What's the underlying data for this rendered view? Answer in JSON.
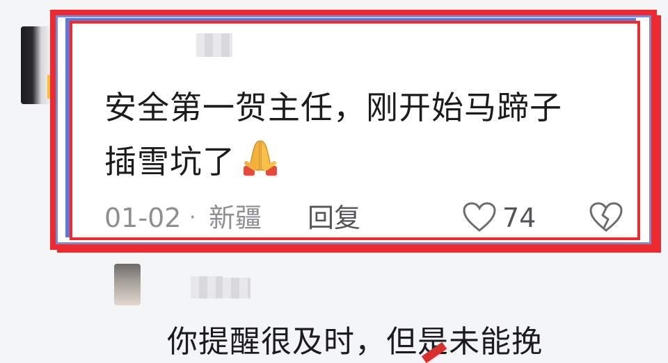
{
  "comment": {
    "text_line1": "安全第一贺主任，刚开始马蹄子",
    "text_line2": "插雪坑了",
    "emoji": "folded-hands",
    "date": "01-02",
    "separator": "·",
    "location": "新疆",
    "reply_label": "回复",
    "like_count": "74"
  },
  "reply": {
    "text": "你提醒很及时，但是未能挽"
  },
  "colors": {
    "highlight_border": "#ec2a2f",
    "secondary_border": "#5f78d6",
    "text": "#1c1c1e",
    "meta": "#8e8e93"
  }
}
